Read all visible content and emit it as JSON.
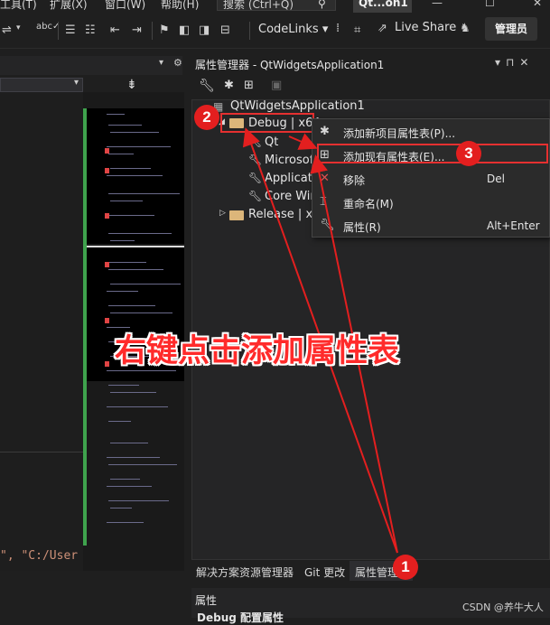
{
  "menubar": {
    "items": [
      "工具(T)",
      "扩展(X)",
      "窗口(W)",
      "帮助(H)"
    ],
    "search_placeholder": "搜索 (Ctrl+Q)",
    "app_title": "Qt...on1"
  },
  "toolbar": {
    "codelinks_label": "CodeLinks",
    "liveshare_label": "Live Share",
    "admin_label": "管理员"
  },
  "property_manager": {
    "title": "属性管理器 - QtWidgetsApplication1",
    "project": "QtWidgetsApplication1",
    "debug_config": "Debug | x64",
    "children": [
      "Qt",
      "Microsof",
      "Applicatio",
      "Core Wir"
    ],
    "release_config": "Release | x6"
  },
  "context_menu": {
    "items": [
      {
        "label": "添加新项目属性表(P)...",
        "shortcut": "",
        "icon": "add-new-sheet-icon"
      },
      {
        "label": "添加现有属性表(E)...",
        "shortcut": "",
        "icon": "add-existing-sheet-icon"
      },
      {
        "label": "移除",
        "shortcut": "Del",
        "icon": "remove-icon"
      },
      {
        "label": "重命名(M)",
        "shortcut": "",
        "icon": "rename-icon"
      },
      {
        "label": "属性(R)",
        "shortcut": "Alt+Enter",
        "icon": "wrench-icon"
      }
    ]
  },
  "editor": {
    "code_fragment": "\", \"C:/User"
  },
  "bottom_tabs": {
    "tabs": [
      "解决方案资源管理器",
      "Git 更改",
      "属性管理器"
    ],
    "active_index": 2
  },
  "properties_panel": {
    "title": "属性",
    "subtitle": "Debug 配置属性"
  },
  "annotations": {
    "caption": "右键点击添加属性表",
    "badge_1": "1",
    "badge_2": "2",
    "badge_3": "3",
    "color": "#e31f1f"
  },
  "watermark": "CSDN @养牛大人"
}
